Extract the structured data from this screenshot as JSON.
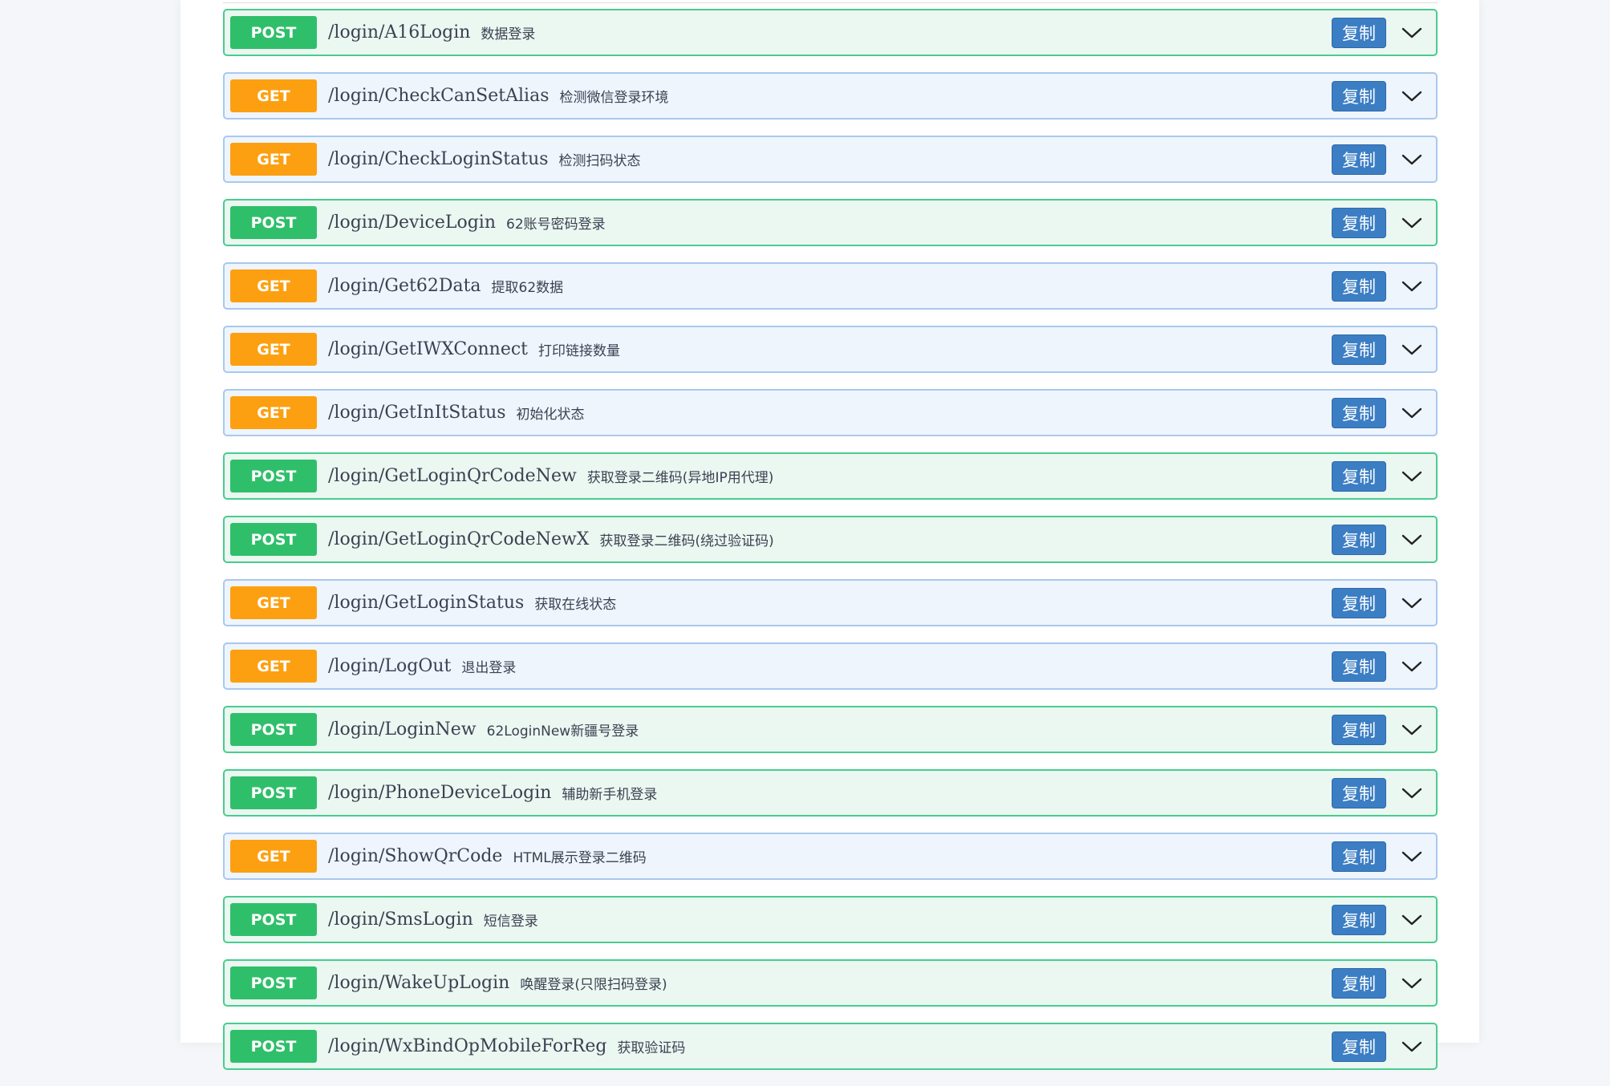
{
  "operations": [
    {
      "method": "POST",
      "path": "/login/A16Login",
      "summary": "数据登录"
    },
    {
      "method": "GET",
      "path": "/login/CheckCanSetAlias",
      "summary": "检测微信登录环境"
    },
    {
      "method": "GET",
      "path": "/login/CheckLoginStatus",
      "summary": "检测扫码状态"
    },
    {
      "method": "POST",
      "path": "/login/DeviceLogin",
      "summary": "62账号密码登录"
    },
    {
      "method": "GET",
      "path": "/login/Get62Data",
      "summary": "提取62数据"
    },
    {
      "method": "GET",
      "path": "/login/GetIWXConnect",
      "summary": "打印链接数量"
    },
    {
      "method": "GET",
      "path": "/login/GetInItStatus",
      "summary": "初始化状态"
    },
    {
      "method": "POST",
      "path": "/login/GetLoginQrCodeNew",
      "summary": "获取登录二维码(异地IP用代理)"
    },
    {
      "method": "POST",
      "path": "/login/GetLoginQrCodeNewX",
      "summary": "获取登录二维码(绕过验证码)"
    },
    {
      "method": "GET",
      "path": "/login/GetLoginStatus",
      "summary": "获取在线状态"
    },
    {
      "method": "GET",
      "path": "/login/LogOut",
      "summary": "退出登录"
    },
    {
      "method": "POST",
      "path": "/login/LoginNew",
      "summary": "62LoginNew新疆号登录"
    },
    {
      "method": "POST",
      "path": "/login/PhoneDeviceLogin",
      "summary": "辅助新手机登录"
    },
    {
      "method": "GET",
      "path": "/login/ShowQrCode",
      "summary": "HTML展示登录二维码"
    },
    {
      "method": "POST",
      "path": "/login/SmsLogin",
      "summary": "短信登录"
    },
    {
      "method": "POST",
      "path": "/login/WakeUpLogin",
      "summary": "唤醒登录(只限扫码登录)"
    },
    {
      "method": "POST",
      "path": "/login/WxBindOpMobileForReg",
      "summary": "获取验证码"
    }
  ],
  "copy_label": "复制",
  "expand_icon": "chevron-down-icon",
  "colors": {
    "post_badge": "#2fbf6a",
    "get_badge": "#fca011",
    "post_row_bg": "#ebf7f1",
    "get_row_bg": "#eef5fd",
    "copy_button": "#3c7ec4"
  }
}
